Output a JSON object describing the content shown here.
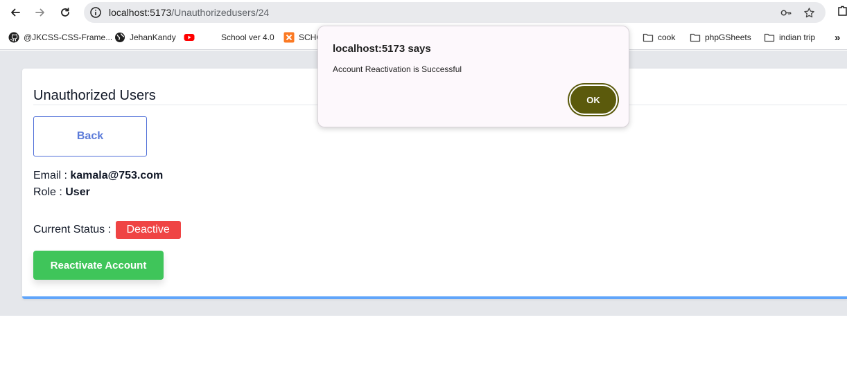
{
  "browser": {
    "url_host": "localhost:5173",
    "url_path": "/Unauthorizedusers/24",
    "bookmarks": [
      {
        "label": "@JKCSS-CSS-Frame...",
        "icon": "github-icon"
      },
      {
        "label": "JehanKandy",
        "icon": "globe-icon"
      },
      {
        "label": "",
        "icon": "youtube-icon"
      },
      {
        "label": "School ver 4.0",
        "icon": ""
      },
      {
        "label": "SCHO",
        "icon": "xampp-icon"
      },
      {
        "label": "cook",
        "icon": "folder-icon"
      },
      {
        "label": "phpGSheets",
        "icon": "folder-icon"
      },
      {
        "label": "indian trip",
        "icon": "folder-icon"
      }
    ],
    "more_bookmarks": "»"
  },
  "page": {
    "title": "Unauthorized Users",
    "back_label": "Back",
    "email_label": "Email : ",
    "email_value": "kamala@753.com",
    "role_label": "Role : ",
    "role_value": "User",
    "status_label": "Current Status : ",
    "status_value": "Deactive",
    "reactivate_label": "Reactivate Account"
  },
  "dialog": {
    "title": "localhost:5173 says",
    "message": "Account Reactivation is Successful",
    "ok_label": "OK"
  },
  "colors": {
    "status_badge": "#ef4444",
    "reactivate": "#3fc55a",
    "card_accent": "#60a5fa",
    "ok_button": "#5b5a0c"
  }
}
